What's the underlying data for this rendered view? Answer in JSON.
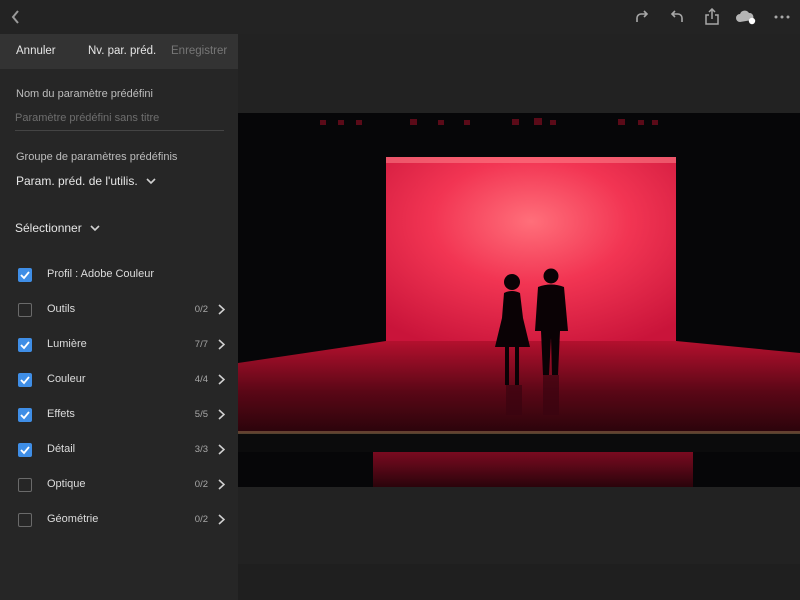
{
  "topbar": {
    "icons": [
      "back-icon",
      "redo-icon",
      "undo-icon",
      "share-icon",
      "cloud-sync-icon",
      "more-icon"
    ]
  },
  "preset_panel": {
    "header": {
      "cancel_label": "Annuler",
      "new_preset_label": "Nv. par. préd.",
      "save_label": "Enregistrer"
    },
    "name": {
      "label": "Nom du paramètre prédéfini",
      "placeholder": "Paramètre prédéfini sans titre",
      "value": ""
    },
    "group": {
      "label": "Groupe de paramètres prédéfinis",
      "selected": "Param. préd. de l'utilis."
    },
    "select": {
      "label": "Sélectionner"
    },
    "items": [
      {
        "label": "Profil : Adobe Couleur",
        "checked": true,
        "count": "",
        "has_chevron": false
      },
      {
        "label": "Outils",
        "checked": false,
        "count": "0/2",
        "has_chevron": true
      },
      {
        "label": "Lumière",
        "checked": true,
        "count": "7/7",
        "has_chevron": true
      },
      {
        "label": "Couleur",
        "checked": true,
        "count": "4/4",
        "has_chevron": true
      },
      {
        "label": "Effets",
        "checked": true,
        "count": "5/5",
        "has_chevron": true
      },
      {
        "label": "Détail",
        "checked": true,
        "count": "3/3",
        "has_chevron": true
      },
      {
        "label": "Optique",
        "checked": false,
        "count": "0/2",
        "has_chevron": true
      },
      {
        "label": "Géométrie",
        "checked": false,
        "count": "0/2",
        "has_chevron": true
      }
    ]
  },
  "colors": {
    "accent": "#3f8ee6",
    "stage_red": "#e8204a"
  },
  "photo": {
    "subject": "silhouette-couple-on-red-stage"
  }
}
